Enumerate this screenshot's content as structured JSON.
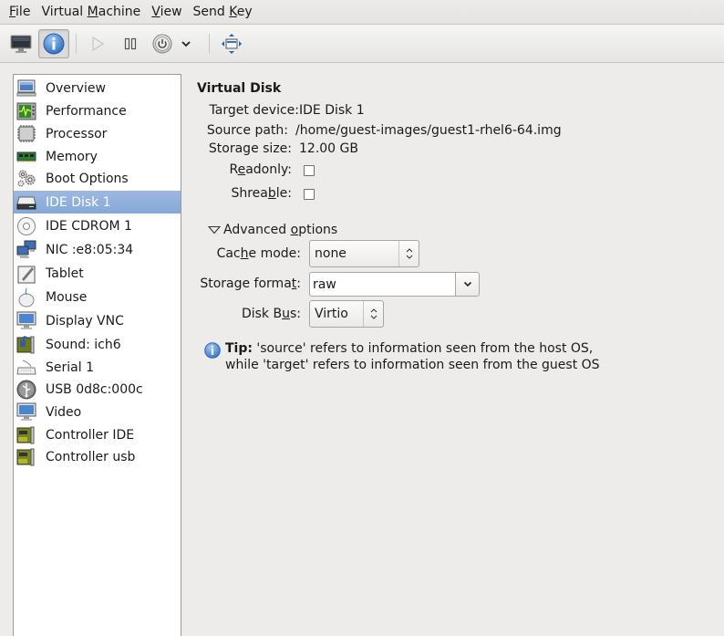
{
  "menubar": {
    "items": [
      {
        "label": "File",
        "mnemonic_index": 0
      },
      {
        "label": "Virtual Machine",
        "mnemonic_index": 8
      },
      {
        "label": "View",
        "mnemonic_index": 0
      },
      {
        "label": "Send Key",
        "mnemonic_index": 5
      }
    ]
  },
  "toolbar": {
    "buttons": [
      {
        "name": "console",
        "icon": "monitor-icon",
        "active": false
      },
      {
        "name": "details",
        "icon": "info-icon",
        "active": true
      },
      {
        "name": "run",
        "icon": "play-icon",
        "active": false,
        "enabled": false
      },
      {
        "name": "pause",
        "icon": "pause-icon",
        "active": false
      },
      {
        "name": "shutdown",
        "icon": "power-icon",
        "active": false
      },
      {
        "name": "shutdown-menu",
        "icon": "chevron-down-icon",
        "active": false
      },
      {
        "name": "fullscreen",
        "icon": "fullscreen-icon",
        "active": false
      }
    ]
  },
  "sidebar": {
    "selected_index": 5,
    "items": [
      {
        "label": "Overview",
        "icon": "monitor-icon"
      },
      {
        "label": "Performance",
        "icon": "performance-icon"
      },
      {
        "label": "Processor",
        "icon": "cpu-icon"
      },
      {
        "label": "Memory",
        "icon": "memory-icon"
      },
      {
        "label": "Boot Options",
        "icon": "gears-icon"
      },
      {
        "label": "IDE Disk 1",
        "icon": "harddisk-icon"
      },
      {
        "label": "IDE CDROM 1",
        "icon": "cdrom-icon"
      },
      {
        "label": "NIC :e8:05:34",
        "icon": "network-icon"
      },
      {
        "label": "Tablet",
        "icon": "tablet-icon"
      },
      {
        "label": "Mouse",
        "icon": "mouse-icon"
      },
      {
        "label": "Display VNC",
        "icon": "display-icon"
      },
      {
        "label": "Sound: ich6",
        "icon": "sound-card-icon"
      },
      {
        "label": "Serial 1",
        "icon": "serial-icon"
      },
      {
        "label": "USB 0d8c:000c",
        "icon": "usb-icon"
      },
      {
        "label": "Video",
        "icon": "video-icon"
      },
      {
        "label": "Controller IDE",
        "icon": "controller-card-icon"
      },
      {
        "label": "Controller usb",
        "icon": "controller-card-icon"
      }
    ]
  },
  "details": {
    "title": "Virtual Disk",
    "target_device_label": "Target device:",
    "target_device": "IDE Disk 1",
    "source_path_label": "Source path:",
    "source_path": "/home/guest-images/guest1-rhel6-64.img",
    "storage_size_label": "Storage size:",
    "storage_size": "12.00 GB",
    "readonly": {
      "pre": "R",
      "mn": "e",
      "post": "adonly:",
      "checked": false
    },
    "shareable": {
      "pre": "Shrea",
      "mn": "b",
      "post": "le:",
      "checked": false
    },
    "advanced": {
      "label_pre": "Advanced ",
      "label_mn": "o",
      "label_post": "ptions",
      "expanded": true,
      "cache_mode": {
        "pre": "Cac",
        "mn": "h",
        "post": "e mode:",
        "value": "none"
      },
      "storage_format": {
        "pre": "Storage forma",
        "mn": "t",
        "post": ":",
        "value": "raw"
      },
      "disk_bus": {
        "pre": "Disk B",
        "mn": "u",
        "post": "s:",
        "value": "Virtio"
      }
    },
    "tip": {
      "bold": "Tip:",
      "line1": " 'source' refers to information seen from the host OS,",
      "line2": "while 'target' refers to information seen from the guest OS"
    }
  },
  "colors": {
    "selection": "#8fafdc",
    "window_bg": "#edecea",
    "info_blue": "#3f7fcf"
  }
}
